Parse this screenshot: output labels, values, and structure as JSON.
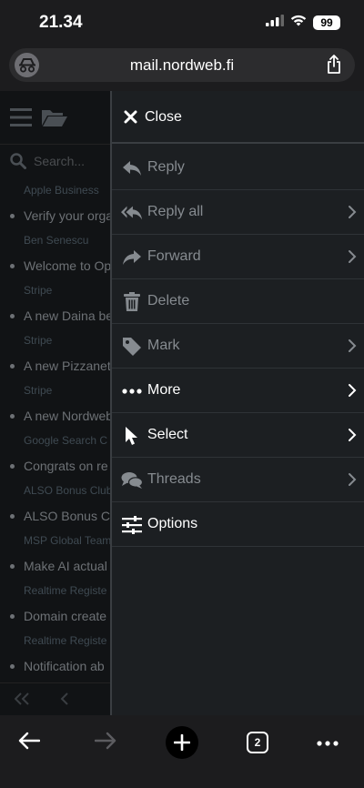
{
  "status_bar": {
    "time": "21.34",
    "battery": "99"
  },
  "browser": {
    "url": "mail.nordweb.fi",
    "tab_count": "2"
  },
  "app": {
    "search_placeholder": "Search...",
    "emails": [
      {
        "sender": "Apple Business",
        "subject": "Verify your orga"
      },
      {
        "sender": "Ben Senescu",
        "subject": "Welcome to Op"
      },
      {
        "sender": "Stripe",
        "subject": "A new Daina be"
      },
      {
        "sender": "Stripe",
        "subject": "A new Pizzanet"
      },
      {
        "sender": "Stripe",
        "subject": "A new Nordweb"
      },
      {
        "sender": "Google Search C",
        "subject": "Congrats on re"
      },
      {
        "sender": "ALSO Bonus Club",
        "subject": "ALSO Bonus Cl"
      },
      {
        "sender": "MSP Global Team",
        "subject": "Make AI actual"
      },
      {
        "sender": "Realtime Registe",
        "subject": "Domain create"
      },
      {
        "sender": "Realtime Registe",
        "subject": "Notification ab"
      }
    ]
  },
  "menu": {
    "close": "Close",
    "items": [
      {
        "label": "Reply",
        "icon": "reply-icon",
        "enabled": false,
        "submenu": false
      },
      {
        "label": "Reply all",
        "icon": "reply-all-icon",
        "enabled": false,
        "submenu": true
      },
      {
        "label": "Forward",
        "icon": "forward-icon",
        "enabled": false,
        "submenu": true
      },
      {
        "label": "Delete",
        "icon": "trash-icon",
        "enabled": false,
        "submenu": false
      },
      {
        "label": "Mark",
        "icon": "tag-icon",
        "enabled": false,
        "submenu": true
      },
      {
        "label": "More",
        "icon": "more-dots-icon",
        "enabled": true,
        "submenu": true
      },
      {
        "label": "Select",
        "icon": "cursor-icon",
        "enabled": true,
        "submenu": true
      },
      {
        "label": "Threads",
        "icon": "threads-icon",
        "enabled": false,
        "submenu": true
      },
      {
        "label": "Options",
        "icon": "sliders-icon",
        "enabled": true,
        "submenu": false
      }
    ]
  },
  "colors": {
    "menu_bg": "#1c1f22",
    "app_bg": "#111315",
    "dim_text": "#868b90",
    "bar_bg": "#1c1c1e"
  }
}
